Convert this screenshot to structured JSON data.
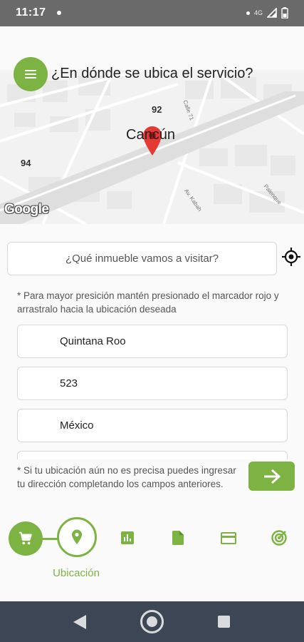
{
  "status_bar": {
    "time": "11:17",
    "network": "4G"
  },
  "header": {
    "title": "¿En dónde se ubica el servicio?",
    "menu_icon": "hamburger-menu-icon"
  },
  "map": {
    "city": "Cancún",
    "labels": [
      "92",
      "94"
    ],
    "streets": [
      "Calle 71",
      "Av. Kabah",
      "Palenque"
    ],
    "brand": "Google",
    "marker_icon": "map-pin-icon"
  },
  "search": {
    "placeholder": "¿Qué inmueble vamos a visitar?",
    "locate_icon": "gps-crosshair-icon"
  },
  "form": {
    "hint_top": "* Para mayor presición mantén presionado el marcador rojo y arrastralo hacia la ubicación deseada",
    "state": "Quintana Roo",
    "number": "523",
    "country": "México",
    "hint_bottom": "* Si tu ubicación aún no es precisa puedes ingresar tu dirección completando los campos anteriores.",
    "next_icon": "arrow-right-icon"
  },
  "steps": {
    "active_label": "Ubicación",
    "icons": [
      "cart-icon",
      "location-pin-icon",
      "chart-icon",
      "document-icon",
      "credit-card-icon",
      "radar-icon"
    ]
  },
  "colors": {
    "accent": "#7cb342",
    "marker": "#e53935",
    "status_bar": "#6a6a6a",
    "nav_bar": "#3c4654"
  }
}
